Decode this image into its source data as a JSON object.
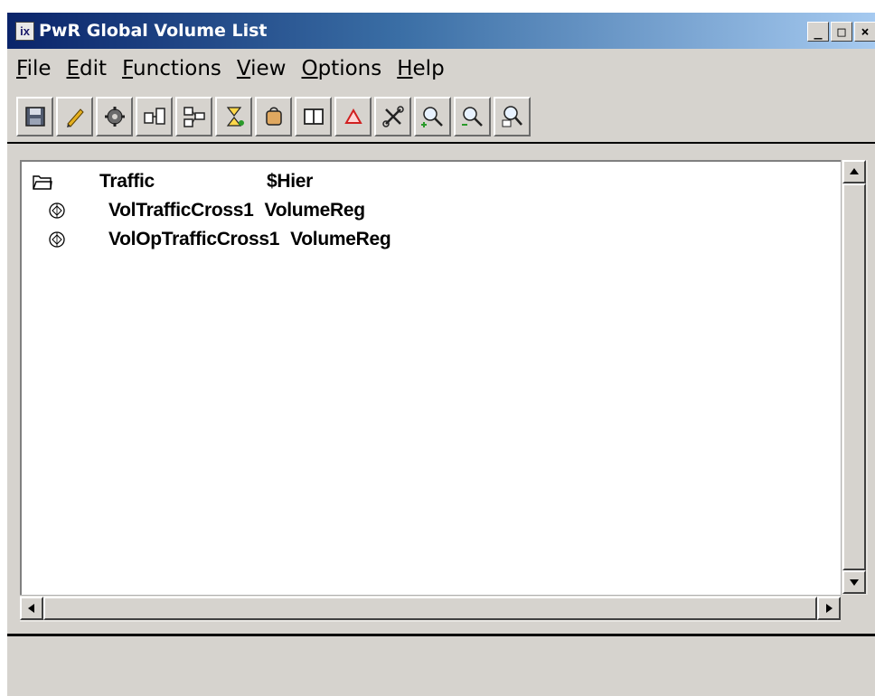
{
  "window": {
    "title": "PwR Global Volume List",
    "icon_text": "ix",
    "controls": {
      "minimize": "_",
      "maximize": "□",
      "close": "×"
    }
  },
  "menubar": {
    "items": [
      {
        "key": "F",
        "rest": "ile"
      },
      {
        "key": "E",
        "rest": "dit"
      },
      {
        "key": "F",
        "rest": "unctions"
      },
      {
        "key": "V",
        "rest": "iew"
      },
      {
        "key": "O",
        "rest": "ptions"
      },
      {
        "key": "H",
        "rest": "elp"
      }
    ]
  },
  "toolbar": {
    "buttons": [
      "save-icon",
      "pencil-icon",
      "gear-icon",
      "connect-icon",
      "structure-icon",
      "hierarchy-icon",
      "bucket-icon",
      "book-icon",
      "triangle-icon",
      "tools-icon",
      "zoom-in-icon",
      "zoom-out-icon",
      "zoom-reset-icon"
    ]
  },
  "tree": {
    "rows": [
      {
        "name": "Traffic",
        "class": "$Hier",
        "icon": "folder-icon"
      },
      {
        "name": "VolTrafficCross1",
        "class": "VolumeReg",
        "icon": "volume-icon"
      },
      {
        "name": "VolOpTrafficCross1",
        "class": "VolumeReg",
        "icon": "volume-icon"
      }
    ]
  },
  "colors": {
    "title_bar_start": "#0a246a",
    "title_bar_end": "#a6caf0",
    "window_bg": "#d6d3ce",
    "list_bg": "#ffffff"
  }
}
